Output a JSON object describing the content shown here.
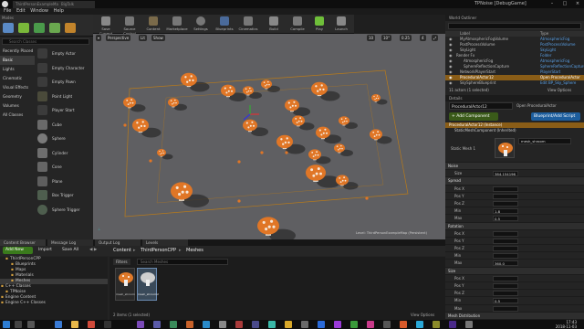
{
  "window": {
    "tab_label": "ThirdPersonExampleMap",
    "tab_label_2": "BigTalk",
    "project_title": "TPNoise [DebugGame]"
  },
  "menu": [
    "File",
    "Edit",
    "Window",
    "Help"
  ],
  "modes": {
    "title": "Modes",
    "search_placeholder": "Search Classes",
    "categories": [
      "Recently Placed",
      "Basic",
      "Lights",
      "Cinematic",
      "Visual Effects",
      "Geometry",
      "Volumes",
      "All Classes"
    ],
    "selected_category": "Basic",
    "items": [
      "Empty Actor",
      "Empty Character",
      "Empty Pawn",
      "Point Light",
      "Player Start",
      "Cube",
      "Sphere",
      "Cylinder",
      "Cone",
      "Plane",
      "Box Trigger",
      "Sphere Trigger"
    ]
  },
  "toolbar": {
    "buttons": [
      "Save Current",
      "Source Control",
      "Content",
      "Marketplace",
      "Settings",
      "Blueprints",
      "Cinematics",
      "Build",
      "Compile",
      "Play",
      "Launch"
    ]
  },
  "viewport": {
    "perspective_label": "Perspective",
    "lit_label": "Lit",
    "show_label": "Show",
    "grid_value": "10",
    "rotation_value": "10°",
    "scale_value": "0.25",
    "camera_speed": "4",
    "level_label": "Level:  ThirdPersonExampleMap (Persistent)"
  },
  "world_outliner": {
    "title": "World Outliner",
    "col_label": "Label",
    "col_type": "Type",
    "rows": [
      {
        "label": "MyAtmosphericFogVolume",
        "type": "AtmosphericFog"
      },
      {
        "label": "PostProcessVolume",
        "type": "PostProcessVolume"
      },
      {
        "label": "SkyLight",
        "type": "SkyLight"
      },
      {
        "label": "Render Fx",
        "type": "Folder"
      },
      {
        "label": "AtmosphericFog",
        "type": "AtmosphericFog"
      },
      {
        "label": "SphereReflectionCapture",
        "type": "SphereReflectionCapture"
      },
      {
        "label": "NetworkPlayerStart",
        "type": "PlayerStart"
      },
      {
        "label": "ProceduralActor12",
        "type": "Open ProceduralActor"
      },
      {
        "label": "SkySphereBlueprint",
        "type": "Edit BP_Sky_Sphere"
      }
    ],
    "selected_index": 7,
    "actor_count": "11 actors (1 selected)",
    "view_options": "View Options"
  },
  "details": {
    "title": "Details",
    "actor_name": "ProceduralActor12",
    "open_link": "Open ProceduralActor",
    "add_component": "+ Add Component",
    "blueprint_add": "Blueprint/Add Script",
    "components": [
      "ProceduralActor12 (Instance)",
      "StaticMeshComponent (Inherited)"
    ],
    "static_mesh_label": "Static Mesh 1",
    "static_mesh_value": "mesh_shroom",
    "sections": [
      {
        "name": "Noise",
        "rows": [
          {
            "k": "Size",
            "v": "384.154196"
          }
        ]
      },
      {
        "name": "Spread",
        "rows": [
          {
            "k": "Pos X",
            "v": ""
          },
          {
            "k": "Pos Y",
            "v": ""
          },
          {
            "k": "Pos Z",
            "v": ""
          },
          {
            "k": "Min",
            "v": "1.8"
          },
          {
            "k": "Max",
            "v": "0.5"
          }
        ]
      },
      {
        "name": "Rotation",
        "rows": [
          {
            "k": "Pos X",
            "v": ""
          },
          {
            "k": "Pos Y",
            "v": ""
          },
          {
            "k": "Pos Z",
            "v": ""
          },
          {
            "k": "Min",
            "v": ""
          },
          {
            "k": "Max",
            "v": "360.0"
          }
        ]
      },
      {
        "name": "Size",
        "rows": [
          {
            "k": "Pos X",
            "v": ""
          },
          {
            "k": "Pos Y",
            "v": ""
          },
          {
            "k": "Pos Z",
            "v": ""
          },
          {
            "k": "Min",
            "v": "0.5"
          },
          {
            "k": "Max",
            "v": ""
          }
        ]
      }
    ],
    "mesh_distribution": "Mesh Distribution"
  },
  "content_browser": {
    "tabs": [
      "Content Browser",
      "Message Log",
      "Output Log",
      "Levels"
    ],
    "add_new": "Add New",
    "import": "Import",
    "save_all": "Save All",
    "path": [
      "Content",
      "ThirdPersonCPP",
      "Meshes"
    ],
    "filters": "Filters",
    "search_placeholder": "Search Meshes",
    "tree": [
      {
        "label": "ThirdPersonCPP",
        "depth": 1
      },
      {
        "label": "Blueprints",
        "depth": 2
      },
      {
        "label": "Maps",
        "depth": 2
      },
      {
        "label": "Materials",
        "depth": 2
      },
      {
        "label": "Meshes",
        "depth": 2
      },
      {
        "label": "C++ Classes",
        "depth": 0
      },
      {
        "label": "TPNoise",
        "depth": 1
      },
      {
        "label": "Engine Content",
        "depth": 0
      },
      {
        "label": "Engine C++ Classes",
        "depth": 0
      }
    ],
    "selected_tree": "Meshes",
    "assets": [
      "mesh_shroom",
      "mesh_shroom2"
    ],
    "item_count": "2 items (1 selected)",
    "view_options": "View Options"
  },
  "taskbar": {
    "time": "17:43",
    "date": "2018-11-03"
  }
}
